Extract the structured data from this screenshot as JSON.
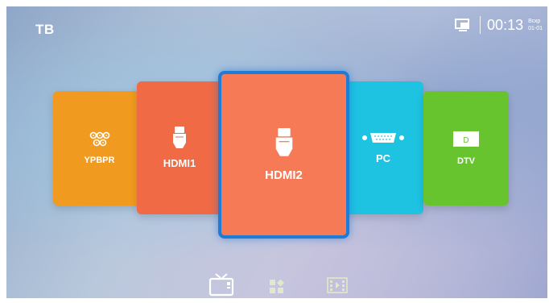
{
  "header": {
    "title": "ТВ"
  },
  "status": {
    "time": "00:13",
    "day": "Вскр",
    "date": "01-01"
  },
  "sources": [
    {
      "label": "YPBPR",
      "icon": "component-icon",
      "color": "#f09b1f"
    },
    {
      "label": "HDMI1",
      "icon": "hdmi-icon",
      "color": "#f06a45"
    },
    {
      "label": "HDMI2",
      "icon": "hdmi-icon",
      "color": "#f57a55",
      "selected": true
    },
    {
      "label": "PC",
      "icon": "vga-icon",
      "color": "#1ec3e2"
    },
    {
      "label": "DTV",
      "icon": "dtv-icon",
      "color": "#67c42e",
      "icon_text": "D"
    }
  ],
  "bottom_nav": [
    {
      "name": "tv",
      "icon": "tv-icon",
      "active": true
    },
    {
      "name": "apps",
      "icon": "apps-icon",
      "active": false
    },
    {
      "name": "media",
      "icon": "media-icon",
      "active": false
    }
  ]
}
